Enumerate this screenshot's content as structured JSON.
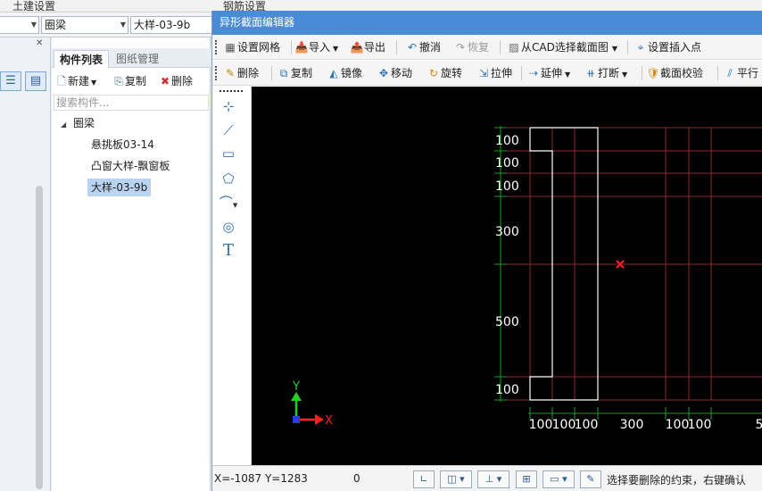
{
  "menu": {
    "item_left": "土建设置",
    "item_right": "钢筋设置"
  },
  "combos": {
    "category": "",
    "type": "圈梁",
    "name": "大样-03-9b"
  },
  "list_panel": {
    "tab_active": "构件列表",
    "tab_inactive": "图纸管理",
    "new_label": "新建",
    "copy_label": "复制",
    "delete_label": "删除",
    "search_placeholder": "搜索构件...",
    "tree_root": "圈梁",
    "items": [
      "悬挑板03-14",
      "凸窗大样-飘窗板",
      "大样-03-9b"
    ]
  },
  "dialog": {
    "title": "异形截面编辑器",
    "toolbar1": {
      "grid": "设置网格",
      "import": "导入",
      "export": "导出",
      "undo": "撤消",
      "redo": "恢复",
      "from_cad": "从CAD选择截面图",
      "insert_point": "设置插入点"
    },
    "toolbar2": {
      "delete": "删除",
      "copy": "复制",
      "mirror": "镜像",
      "move": "移动",
      "rotate": "旋转",
      "stretch": "拉伸",
      "extend": "延伸",
      "break": "打断",
      "check": "截面校验",
      "parallel": "平行"
    },
    "drawtools": [
      "point-tool",
      "line-tool",
      "rectangle-tool",
      "polygon-tool",
      "arc-tool",
      "circle-tool",
      "text-tool"
    ],
    "text_tool_glyph": "T"
  },
  "canvas": {
    "left_dims": [
      "100",
      "100",
      "100",
      "300",
      "500",
      "100"
    ],
    "bottom_dims": [
      "100",
      "100",
      "100",
      "300",
      "100",
      "100",
      "5"
    ],
    "axis_x": "X",
    "axis_y": "Y",
    "colors": {
      "background": "#000000",
      "grid_red": "#8a2a2a",
      "grid_green": "#1f9a1f",
      "shape": "#ffffff",
      "marker": "#ff2020",
      "axis_x": "#ff2020",
      "axis_y": "#20d020"
    }
  },
  "status": {
    "coords": "X=-1087 Y=1283",
    "angle": "0",
    "message": "选择要删除的约束，右键确认"
  }
}
